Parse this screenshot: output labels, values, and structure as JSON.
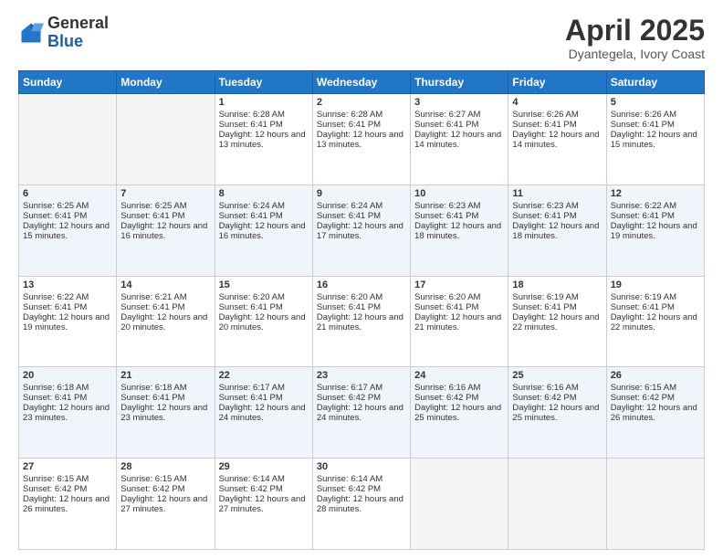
{
  "logo": {
    "general": "General",
    "blue": "Blue"
  },
  "title": "April 2025",
  "location": "Dyantegela, Ivory Coast",
  "days_of_week": [
    "Sunday",
    "Monday",
    "Tuesday",
    "Wednesday",
    "Thursday",
    "Friday",
    "Saturday"
  ],
  "weeks": [
    [
      {
        "num": "",
        "sunrise": "",
        "sunset": "",
        "daylight": ""
      },
      {
        "num": "",
        "sunrise": "",
        "sunset": "",
        "daylight": ""
      },
      {
        "num": "1",
        "sunrise": "Sunrise: 6:28 AM",
        "sunset": "Sunset: 6:41 PM",
        "daylight": "Daylight: 12 hours and 13 minutes."
      },
      {
        "num": "2",
        "sunrise": "Sunrise: 6:28 AM",
        "sunset": "Sunset: 6:41 PM",
        "daylight": "Daylight: 12 hours and 13 minutes."
      },
      {
        "num": "3",
        "sunrise": "Sunrise: 6:27 AM",
        "sunset": "Sunset: 6:41 PM",
        "daylight": "Daylight: 12 hours and 14 minutes."
      },
      {
        "num": "4",
        "sunrise": "Sunrise: 6:26 AM",
        "sunset": "Sunset: 6:41 PM",
        "daylight": "Daylight: 12 hours and 14 minutes."
      },
      {
        "num": "5",
        "sunrise": "Sunrise: 6:26 AM",
        "sunset": "Sunset: 6:41 PM",
        "daylight": "Daylight: 12 hours and 15 minutes."
      }
    ],
    [
      {
        "num": "6",
        "sunrise": "Sunrise: 6:25 AM",
        "sunset": "Sunset: 6:41 PM",
        "daylight": "Daylight: 12 hours and 15 minutes."
      },
      {
        "num": "7",
        "sunrise": "Sunrise: 6:25 AM",
        "sunset": "Sunset: 6:41 PM",
        "daylight": "Daylight: 12 hours and 16 minutes."
      },
      {
        "num": "8",
        "sunrise": "Sunrise: 6:24 AM",
        "sunset": "Sunset: 6:41 PM",
        "daylight": "Daylight: 12 hours and 16 minutes."
      },
      {
        "num": "9",
        "sunrise": "Sunrise: 6:24 AM",
        "sunset": "Sunset: 6:41 PM",
        "daylight": "Daylight: 12 hours and 17 minutes."
      },
      {
        "num": "10",
        "sunrise": "Sunrise: 6:23 AM",
        "sunset": "Sunset: 6:41 PM",
        "daylight": "Daylight: 12 hours and 18 minutes."
      },
      {
        "num": "11",
        "sunrise": "Sunrise: 6:23 AM",
        "sunset": "Sunset: 6:41 PM",
        "daylight": "Daylight: 12 hours and 18 minutes."
      },
      {
        "num": "12",
        "sunrise": "Sunrise: 6:22 AM",
        "sunset": "Sunset: 6:41 PM",
        "daylight": "Daylight: 12 hours and 19 minutes."
      }
    ],
    [
      {
        "num": "13",
        "sunrise": "Sunrise: 6:22 AM",
        "sunset": "Sunset: 6:41 PM",
        "daylight": "Daylight: 12 hours and 19 minutes."
      },
      {
        "num": "14",
        "sunrise": "Sunrise: 6:21 AM",
        "sunset": "Sunset: 6:41 PM",
        "daylight": "Daylight: 12 hours and 20 minutes."
      },
      {
        "num": "15",
        "sunrise": "Sunrise: 6:20 AM",
        "sunset": "Sunset: 6:41 PM",
        "daylight": "Daylight: 12 hours and 20 minutes."
      },
      {
        "num": "16",
        "sunrise": "Sunrise: 6:20 AM",
        "sunset": "Sunset: 6:41 PM",
        "daylight": "Daylight: 12 hours and 21 minutes."
      },
      {
        "num": "17",
        "sunrise": "Sunrise: 6:20 AM",
        "sunset": "Sunset: 6:41 PM",
        "daylight": "Daylight: 12 hours and 21 minutes."
      },
      {
        "num": "18",
        "sunrise": "Sunrise: 6:19 AM",
        "sunset": "Sunset: 6:41 PM",
        "daylight": "Daylight: 12 hours and 22 minutes."
      },
      {
        "num": "19",
        "sunrise": "Sunrise: 6:19 AM",
        "sunset": "Sunset: 6:41 PM",
        "daylight": "Daylight: 12 hours and 22 minutes."
      }
    ],
    [
      {
        "num": "20",
        "sunrise": "Sunrise: 6:18 AM",
        "sunset": "Sunset: 6:41 PM",
        "daylight": "Daylight: 12 hours and 23 minutes."
      },
      {
        "num": "21",
        "sunrise": "Sunrise: 6:18 AM",
        "sunset": "Sunset: 6:41 PM",
        "daylight": "Daylight: 12 hours and 23 minutes."
      },
      {
        "num": "22",
        "sunrise": "Sunrise: 6:17 AM",
        "sunset": "Sunset: 6:41 PM",
        "daylight": "Daylight: 12 hours and 24 minutes."
      },
      {
        "num": "23",
        "sunrise": "Sunrise: 6:17 AM",
        "sunset": "Sunset: 6:42 PM",
        "daylight": "Daylight: 12 hours and 24 minutes."
      },
      {
        "num": "24",
        "sunrise": "Sunrise: 6:16 AM",
        "sunset": "Sunset: 6:42 PM",
        "daylight": "Daylight: 12 hours and 25 minutes."
      },
      {
        "num": "25",
        "sunrise": "Sunrise: 6:16 AM",
        "sunset": "Sunset: 6:42 PM",
        "daylight": "Daylight: 12 hours and 25 minutes."
      },
      {
        "num": "26",
        "sunrise": "Sunrise: 6:15 AM",
        "sunset": "Sunset: 6:42 PM",
        "daylight": "Daylight: 12 hours and 26 minutes."
      }
    ],
    [
      {
        "num": "27",
        "sunrise": "Sunrise: 6:15 AM",
        "sunset": "Sunset: 6:42 PM",
        "daylight": "Daylight: 12 hours and 26 minutes."
      },
      {
        "num": "28",
        "sunrise": "Sunrise: 6:15 AM",
        "sunset": "Sunset: 6:42 PM",
        "daylight": "Daylight: 12 hours and 27 minutes."
      },
      {
        "num": "29",
        "sunrise": "Sunrise: 6:14 AM",
        "sunset": "Sunset: 6:42 PM",
        "daylight": "Daylight: 12 hours and 27 minutes."
      },
      {
        "num": "30",
        "sunrise": "Sunrise: 6:14 AM",
        "sunset": "Sunset: 6:42 PM",
        "daylight": "Daylight: 12 hours and 28 minutes."
      },
      {
        "num": "",
        "sunrise": "",
        "sunset": "",
        "daylight": ""
      },
      {
        "num": "",
        "sunrise": "",
        "sunset": "",
        "daylight": ""
      },
      {
        "num": "",
        "sunrise": "",
        "sunset": "",
        "daylight": ""
      }
    ]
  ]
}
